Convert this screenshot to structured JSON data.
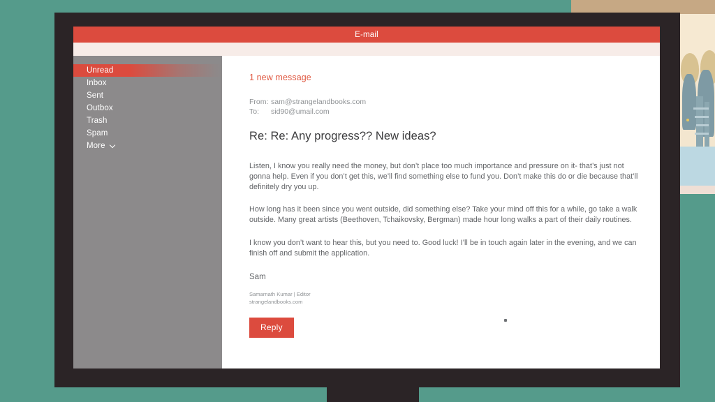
{
  "window": {
    "title": "E-mail"
  },
  "sidebar": {
    "items": [
      {
        "label": "Unread",
        "active": true
      },
      {
        "label": "Inbox",
        "active": false
      },
      {
        "label": "Sent",
        "active": false
      },
      {
        "label": "Outbox",
        "active": false
      },
      {
        "label": "Trash",
        "active": false
      },
      {
        "label": "Spam",
        "active": false
      },
      {
        "label": "More",
        "active": false,
        "icon": "chevron-down-icon"
      }
    ]
  },
  "message": {
    "new_message_notice": "1 new message",
    "from_label": "From:",
    "from_value": "sam@strangelandbooks.com",
    "to_label": "To:",
    "to_value": "sid90@umail.com",
    "subject": "Re: Re: Any progress?? New ideas?",
    "paragraphs": [
      "Listen, I know you really need the money, but don’t place too much importance and pressure on it- that’s just not gonna help. Even if you don’t get this, we’ll find something else to fund you. Don’t make this do or die because that’ll definitely dry you up.",
      "How long has it been since you went outside, did something else? Take your mind off this for a while, go take a walk outside. Many great artists (Beethoven, Tchaikovsky, Bergman) made hour long walks a part of their daily routines.",
      "I know you don’t want to hear this, but you need to. Good luck! I’ll be in touch again later in the evening, and we can finish off and submit the application."
    ],
    "signoff": "Sam",
    "signature_name": "Samarnath Kumar | Editor",
    "signature_site": "strangelandbooks.com",
    "reply_label": "Reply"
  },
  "colors": {
    "accent_red": "#dc4b3e",
    "sidebar_gray": "#8c8a8b",
    "wall_teal": "#559b8b",
    "wall_tan": "#c6a884",
    "monitor_frame": "#2b2426",
    "toolbar_cream": "#f7ece8",
    "body_text": "#636568"
  }
}
